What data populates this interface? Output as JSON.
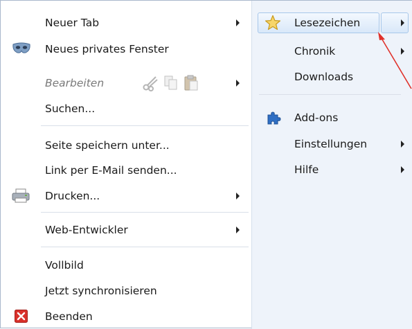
{
  "left_menu": {
    "items": [
      {
        "label": "Neuer Tab"
      },
      {
        "label": "Neues privates Fenster"
      },
      {
        "label": "Bearbeiten"
      },
      {
        "label": "Suchen..."
      },
      {
        "label": "Seite speichern unter..."
      },
      {
        "label": "Link per E-Mail senden..."
      },
      {
        "label": "Drucken..."
      },
      {
        "label": "Web-Entwickler"
      },
      {
        "label": "Vollbild"
      },
      {
        "label": "Jetzt synchronisieren"
      },
      {
        "label": "Beenden"
      }
    ]
  },
  "right_menu": {
    "items": [
      {
        "label": "Lesezeichen"
      },
      {
        "label": "Chronik"
      },
      {
        "label": "Downloads"
      },
      {
        "label": "Add-ons"
      },
      {
        "label": "Einstellungen"
      },
      {
        "label": "Hilfe"
      }
    ]
  },
  "icons": {
    "private_window": "mask-icon",
    "edit_cut": "scissors-icon",
    "edit_copy": "copy-icon",
    "edit_paste": "paste-icon",
    "print": "printer-icon",
    "quit": "close-icon",
    "bookmarks": "star-icon",
    "addons": "puzzle-icon"
  },
  "colors": {
    "highlight_border": "#a7c7ea",
    "right_panel_bg": "#eef3fa",
    "annotation_arrow": "#e0322b",
    "quit_icon": "#d9312b",
    "star": "#f5c542",
    "puzzle": "#2f6fc4"
  }
}
